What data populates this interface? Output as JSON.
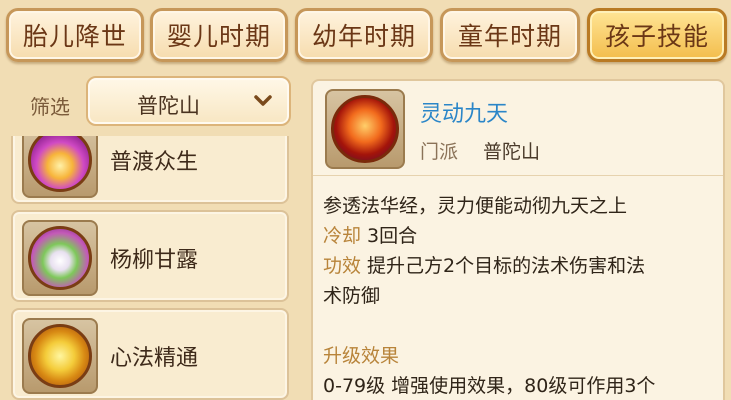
{
  "tabs": [
    {
      "label": "胎儿降世",
      "active": false
    },
    {
      "label": "婴儿时期",
      "active": false
    },
    {
      "label": "幼年时期",
      "active": false
    },
    {
      "label": "童年时期",
      "active": false
    },
    {
      "label": "孩子技能",
      "active": true
    }
  ],
  "filter": {
    "label": "筛选",
    "selected": "普陀山",
    "icon": "chevron-down-icon"
  },
  "skills": [
    {
      "name": "普渡众生",
      "icon": "lotus-icon"
    },
    {
      "name": "杨柳甘露",
      "icon": "willow-vase-icon"
    },
    {
      "name": "心法精通",
      "icon": "golden-idol-icon"
    }
  ],
  "detail": {
    "name": "灵动九天",
    "icon": "flame-spirit-icon",
    "school_label": "门派",
    "school_value": "普陀山",
    "description": "参透法华经，灵力便能动彻九天之上",
    "cooldown_label": "冷却",
    "cooldown_value": "3回合",
    "effect_label": "功效",
    "effect_value_line1": "提升己方2个目标的法术伤害和法",
    "effect_value_line2": "术防御",
    "upgrade_title": "升级效果",
    "upgrade_line": "0-79级 增强使用效果，80级可作用3个"
  },
  "colors": {
    "background": "#f1ddb4",
    "active_tab": "#f3bd4c",
    "skill_name": "#2b86c8",
    "key_label": "#b8843a"
  }
}
